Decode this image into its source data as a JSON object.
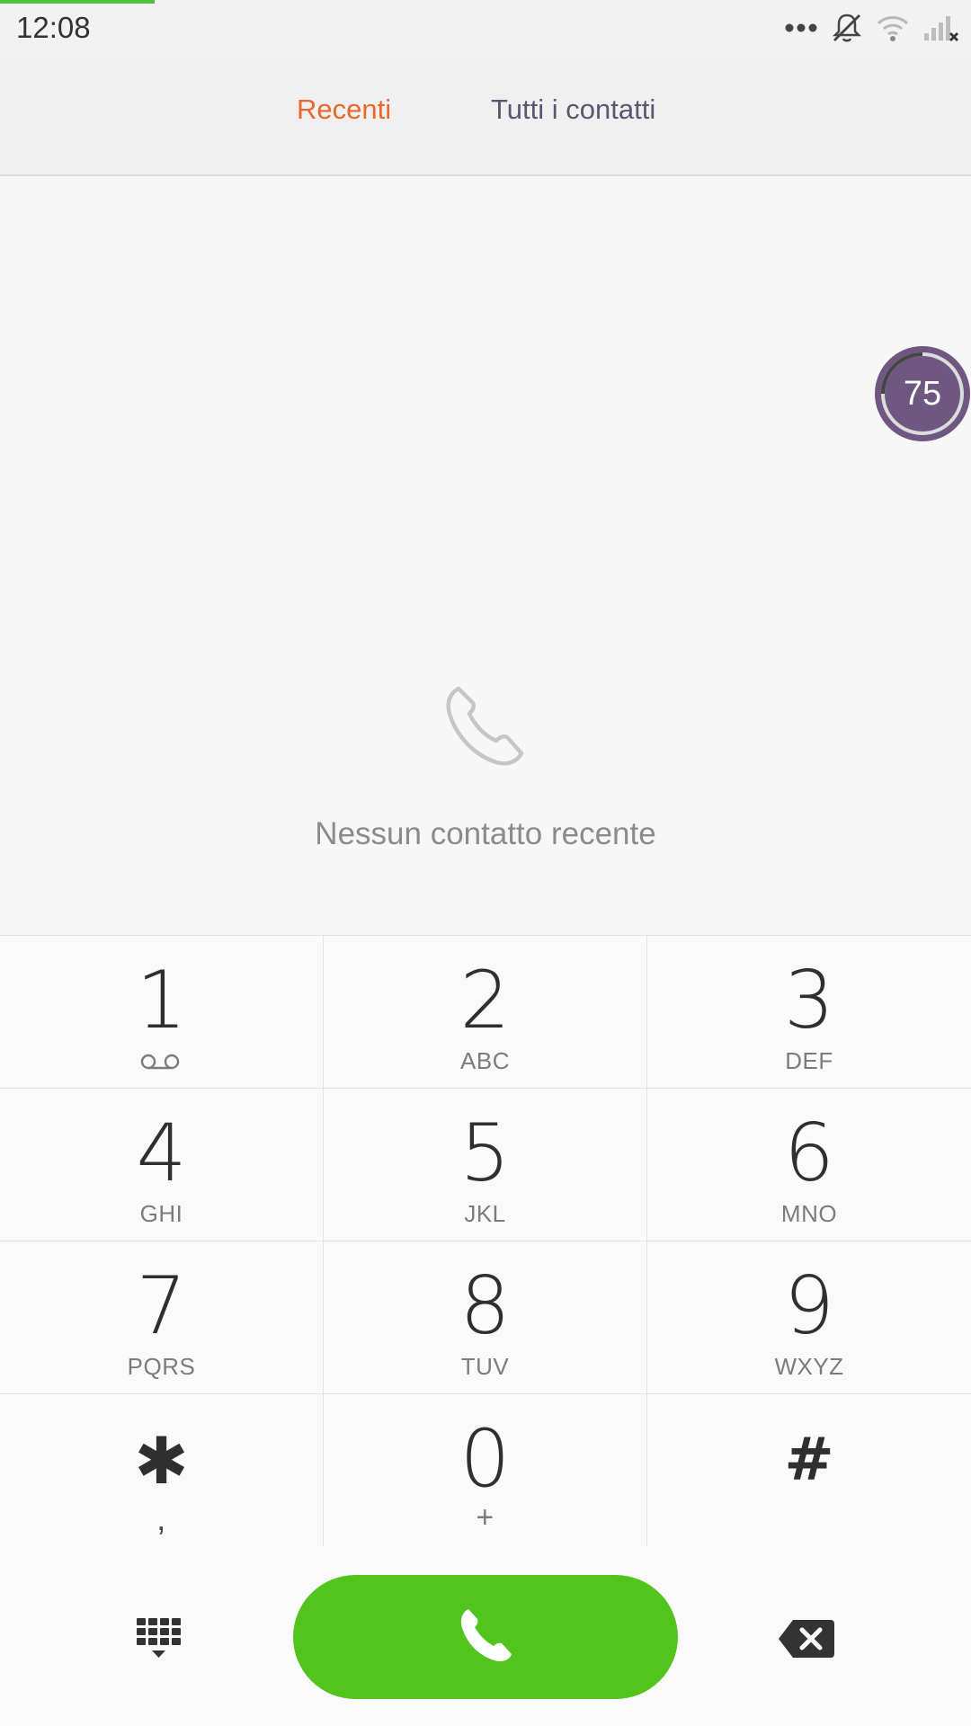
{
  "status_bar": {
    "time": "12:08",
    "icons": [
      "more-dots-icon",
      "silent-bell-icon",
      "wifi-icon",
      "signal-no-service-icon"
    ]
  },
  "tabs": [
    {
      "label": "Recenti",
      "active": true
    },
    {
      "label": "Tutti i contatti",
      "active": false
    }
  ],
  "empty_state": {
    "icon": "phone-outline-icon",
    "message": "Nessun contatto recente"
  },
  "floating_badge": {
    "value": "75",
    "progress_percent": 75,
    "color": "#6f5781"
  },
  "keypad": {
    "keys": [
      {
        "digit": "1",
        "letters": ""
      },
      {
        "digit": "2",
        "letters": "ABC"
      },
      {
        "digit": "3",
        "letters": "DEF"
      },
      {
        "digit": "4",
        "letters": "GHI"
      },
      {
        "digit": "5",
        "letters": "JKL"
      },
      {
        "digit": "6",
        "letters": "MNO"
      },
      {
        "digit": "7",
        "letters": "PQRS"
      },
      {
        "digit": "8",
        "letters": "TUV"
      },
      {
        "digit": "9",
        "letters": "WXYZ"
      },
      {
        "digit": "✱",
        "letters": ","
      },
      {
        "digit": "0",
        "letters": "+"
      },
      {
        "digit": "#",
        "letters": ""
      }
    ]
  },
  "actions": {
    "keypad_toggle_icon": "dialpad-icon",
    "call_icon": "phone-icon",
    "backspace_icon": "backspace-icon"
  },
  "colors": {
    "accent_active_tab": "#e8692b",
    "inactive_tab": "#5e5570",
    "call_green": "#52c41e"
  }
}
